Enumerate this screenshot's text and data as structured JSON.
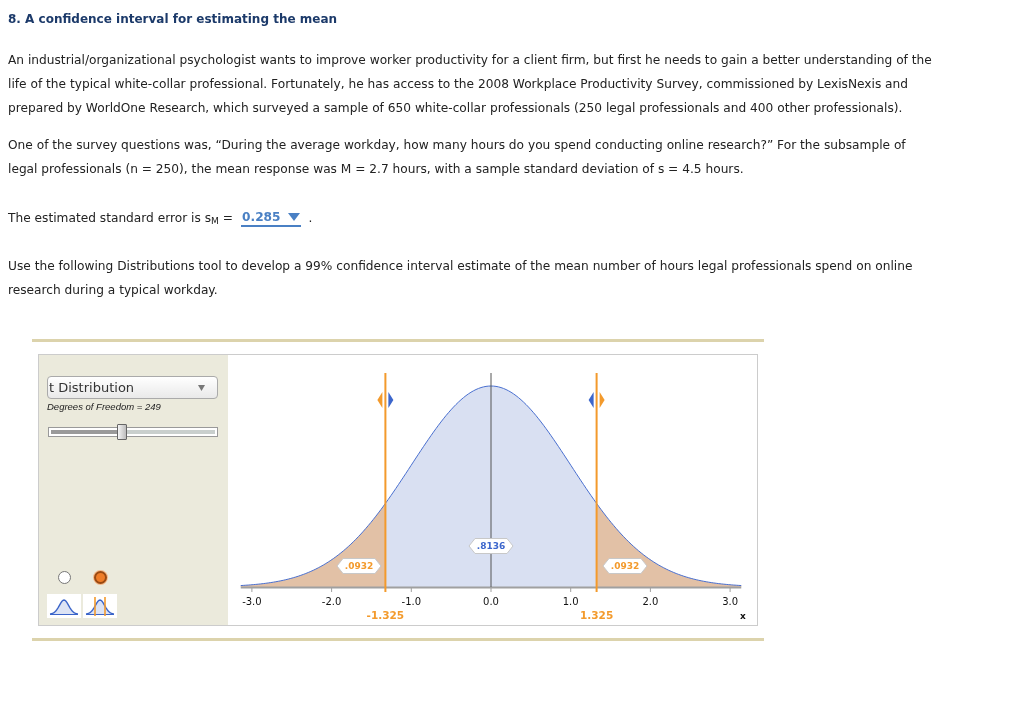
{
  "question": {
    "title": "8. A confidence interval for estimating the mean",
    "paragraphs": [
      "An industrial/organizational psychologist wants to improve worker productivity for a client firm, but first he needs to gain a better understanding of the life of the typical white-collar professional. Fortunately, he has access to the 2008 Workplace Productivity Survey, commissioned by LexisNexis and prepared by WorldOne Research, which surveyed a sample of 650 white-collar professionals (250 legal professionals and 400 other professionals).",
      "One of the survey questions was, “During the average workday, how many hours do you spend conducting online research?” For the subsample of legal professionals (n = 250), the mean response was M = 2.7 hours, with a sample standard deviation of s = 4.5 hours."
    ]
  },
  "standard_error": {
    "label": "The estimated standard error is s$_{M}$ =",
    "value": "0.285",
    "after": "."
  },
  "instruction": "Use the following Distributions tool to develop a 99% confidence interval estimate of the mean number of hours legal professionals spend on online research during a typical workday.",
  "distributions_tool": {
    "distribution_menu": {
      "value": "t Distribution"
    },
    "degrees_of_freedom": {
      "label": "Degrees of Freedom = 249",
      "level": 0.43
    },
    "view_modes": [
      {
        "kind": "curve",
        "selected": false
      },
      {
        "kind": "cutoffs",
        "selected": true
      }
    ],
    "x_ticks": [
      "-3.0",
      "-2.0",
      "-1.0",
      "0.0",
      "1.0",
      "2.0",
      "3.0"
    ],
    "axis_label": "x",
    "cutoffs": [
      {
        "value": "-1.325"
      },
      {
        "value": "1.325"
      }
    ],
    "areas": [
      {
        "kind": "tail",
        "value": ".0932"
      },
      {
        "kind": "center",
        "value": ".8136"
      },
      {
        "kind": "tail",
        "value": ".0932"
      }
    ]
  }
}
